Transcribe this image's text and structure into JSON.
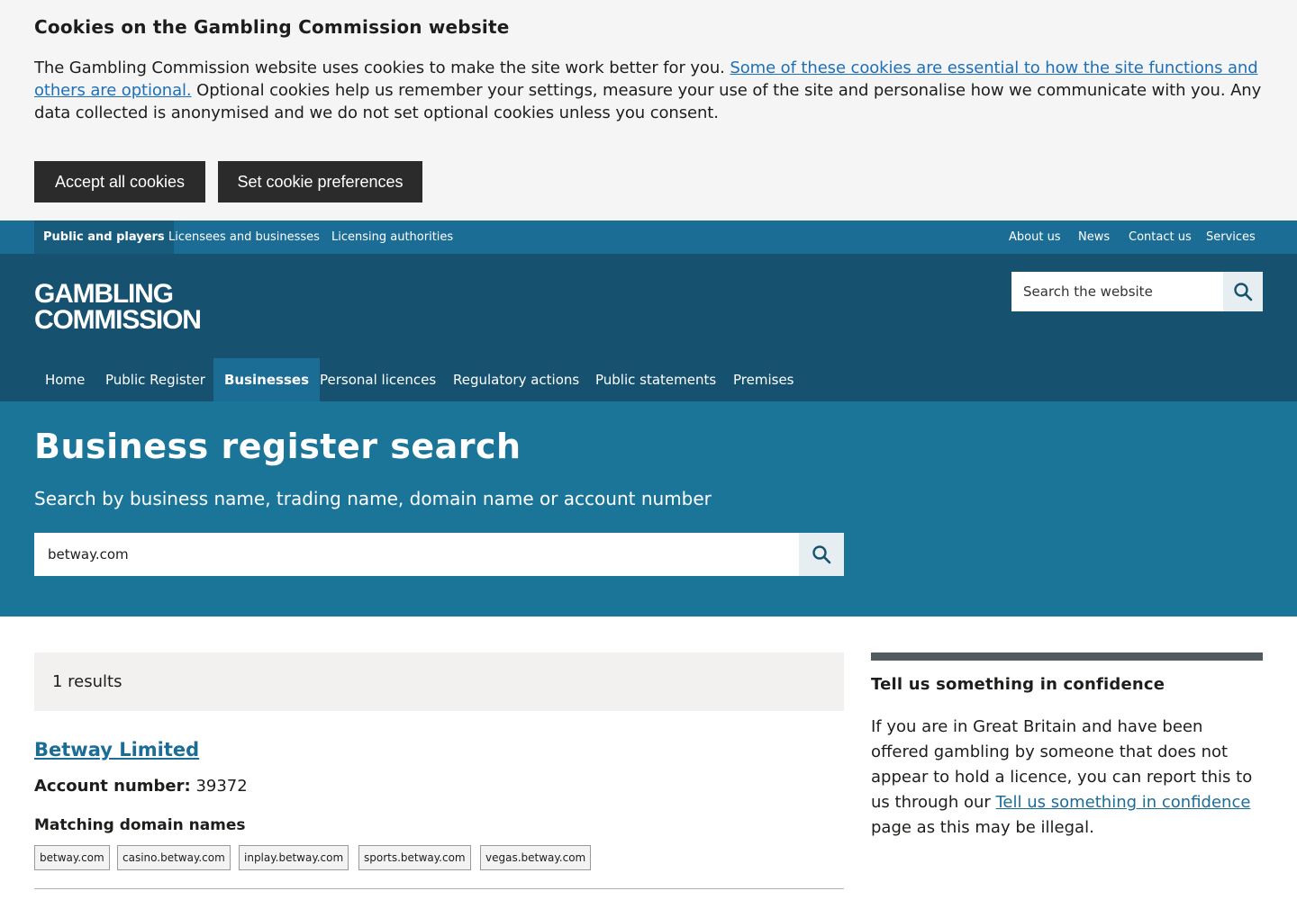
{
  "cookie_banner": {
    "title": "Cookies on the Gambling Commission website",
    "text_intro": "The Gambling Commission website uses cookies to make the site work better for you. ",
    "text_link": "Some of these cookies are essential to how the site functions and others are optional.",
    "text_rest": " Optional cookies help us remember your settings, measure your use of the site and personalise how we communicate with you. Any data collected is anonymised and we do not set optional cookies unless you consent.",
    "accept_label": "Accept all cookies",
    "prefs_label": "Set cookie preferences"
  },
  "top_nav": {
    "left": [
      "Public and players",
      "Licensees and businesses",
      "Licensing authorities"
    ],
    "right": [
      "About us",
      "News",
      "Contact us",
      "Services"
    ]
  },
  "header": {
    "logo_line1": "GAMBLING",
    "logo_line2": "COMMISSION",
    "search_placeholder": "Search the website"
  },
  "main_nav": [
    "Home",
    "Public Register",
    "Businesses",
    "Personal licences",
    "Regulatory actions",
    "Public statements",
    "Premises"
  ],
  "hero": {
    "title": "Business register search",
    "subtitle": "Search by business name, trading name, domain name or account number",
    "search_value": "betway.com"
  },
  "results": {
    "count_text": "1 results",
    "business_name": "Betway Limited",
    "account_label": "Account number:",
    "account_number": "39372",
    "domains_heading": "Matching domain names",
    "domains": [
      "betway.com",
      "casino.betway.com",
      "inplay.betway.com",
      "sports.betway.com",
      "vegas.betway.com"
    ]
  },
  "sidebar": {
    "title": "Tell us something in confidence",
    "text_before": "If you are in Great Britain and have been offered gambling by someone that does not appear to hold a licence, you can report this to us through our ",
    "link": "Tell us something in confidence",
    "text_after": " page as this may be illegal."
  },
  "colors": {
    "top_nav": "#1c6d96",
    "header": "#165270",
    "hero": "#1b7599",
    "link": "#1c6d96",
    "cookie_button": "#2b2b2b"
  }
}
